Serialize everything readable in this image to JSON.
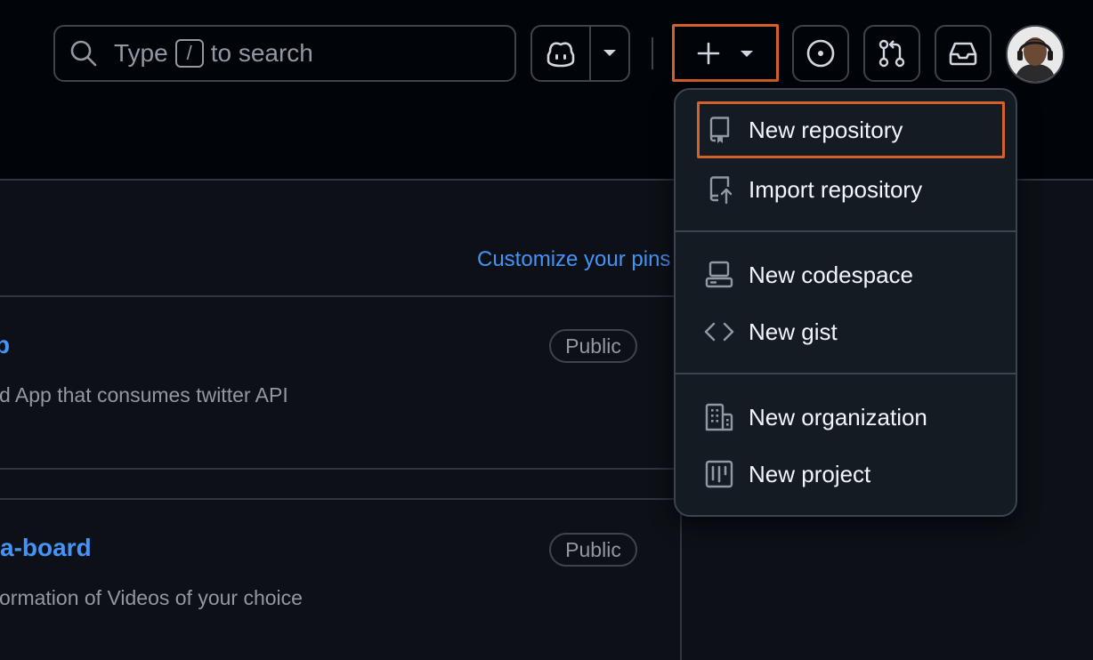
{
  "header": {
    "search": {
      "prefix": "Type",
      "key": "/",
      "suffix": "to search"
    }
  },
  "main": {
    "customize_link": "Customize your pins",
    "repos": [
      {
        "name": "p",
        "description": "d App that consumes twitter API",
        "visibility": "Public"
      },
      {
        "name": "a-board",
        "description": "ormation of Videos of your choice",
        "visibility": "Public"
      }
    ]
  },
  "create_menu": {
    "items": [
      {
        "label": "New repository",
        "icon": "repo-icon"
      },
      {
        "label": "Import repository",
        "icon": "repo-push-icon"
      },
      {
        "label": "New codespace",
        "icon": "codespaces-icon"
      },
      {
        "label": "New gist",
        "icon": "code-icon"
      },
      {
        "label": "New organization",
        "icon": "organization-icon"
      },
      {
        "label": "New project",
        "icon": "project-icon"
      }
    ]
  },
  "colors": {
    "background": "#0d1117",
    "header_bg": "#010409",
    "link": "#4493f8",
    "highlight": "#d4602a",
    "menu_bg": "#151b23"
  }
}
